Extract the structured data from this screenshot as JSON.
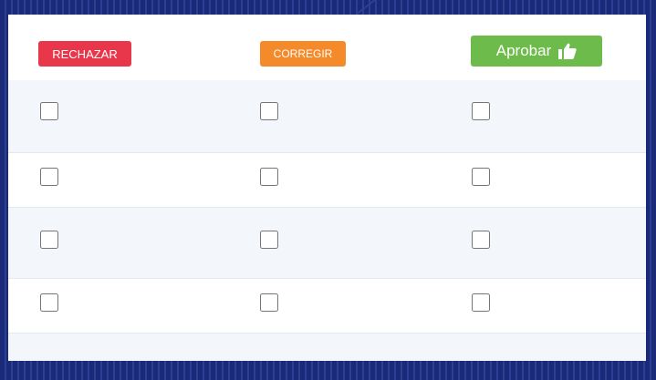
{
  "actions": {
    "reject_label": "RECHAZAR",
    "correct_label": "CORREGIR",
    "approve_label": "Aprobar",
    "approve_icon": "thumbs-up-icon"
  },
  "colors": {
    "reject": "#e8364a",
    "correct": "#f48a2a",
    "approve": "#6dbb4a",
    "frame": "#1b2a78",
    "row_alt": "#f3f7fb"
  },
  "rows": [
    {
      "reject": false,
      "correct": false,
      "approve": false
    },
    {
      "reject": false,
      "correct": false,
      "approve": false
    },
    {
      "reject": false,
      "correct": false,
      "approve": false
    },
    {
      "reject": false,
      "correct": false,
      "approve": false
    }
  ]
}
